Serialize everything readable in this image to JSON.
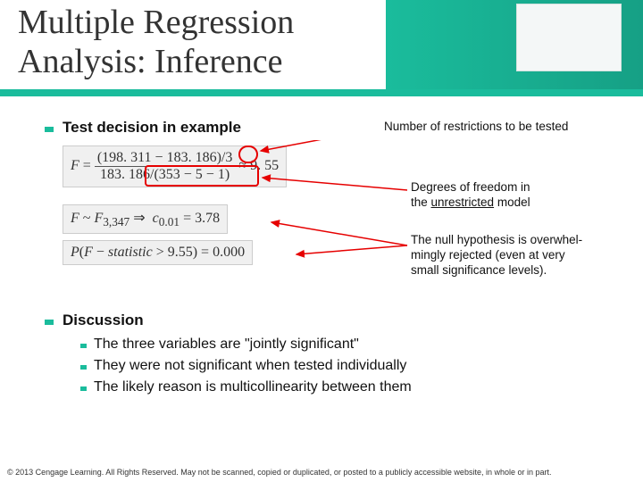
{
  "title_line1": "Multiple Regression",
  "title_line2": "Analysis: Inference",
  "section_test": "Test decision in example",
  "formula_f": "F = (198.311 − 183.186)/3 / (183.186/(353 − 5 − 1)) ≈ 9.55",
  "formula_dist": "F ~ F₃,₃₄₇  ⇒  c₀.₀₁ = 3.78",
  "formula_p": "P(F − statistic > 9.55) = 0.000",
  "ann_num_restr": "Number of restrictions to be tested",
  "ann_df_l1": "Degrees of freedom in",
  "ann_df_l2": "the unrestricted model",
  "ann_null_l1": "The null hypothesis is overwhel-",
  "ann_null_l2": "mingly rejected (even at very",
  "ann_null_l3": "small significance levels).",
  "section_discussion": "Discussion",
  "bullets": {
    "b1": "The three variables are \"jointly significant\"",
    "b2": "They were not significant when tested individually",
    "b3": "The likely reason is multicollinearity between them"
  },
  "footer": "© 2013 Cengage Learning. All Rights Reserved. May not be scanned, copied or duplicated, or posted to a publicly accessible website, in whole or in part."
}
